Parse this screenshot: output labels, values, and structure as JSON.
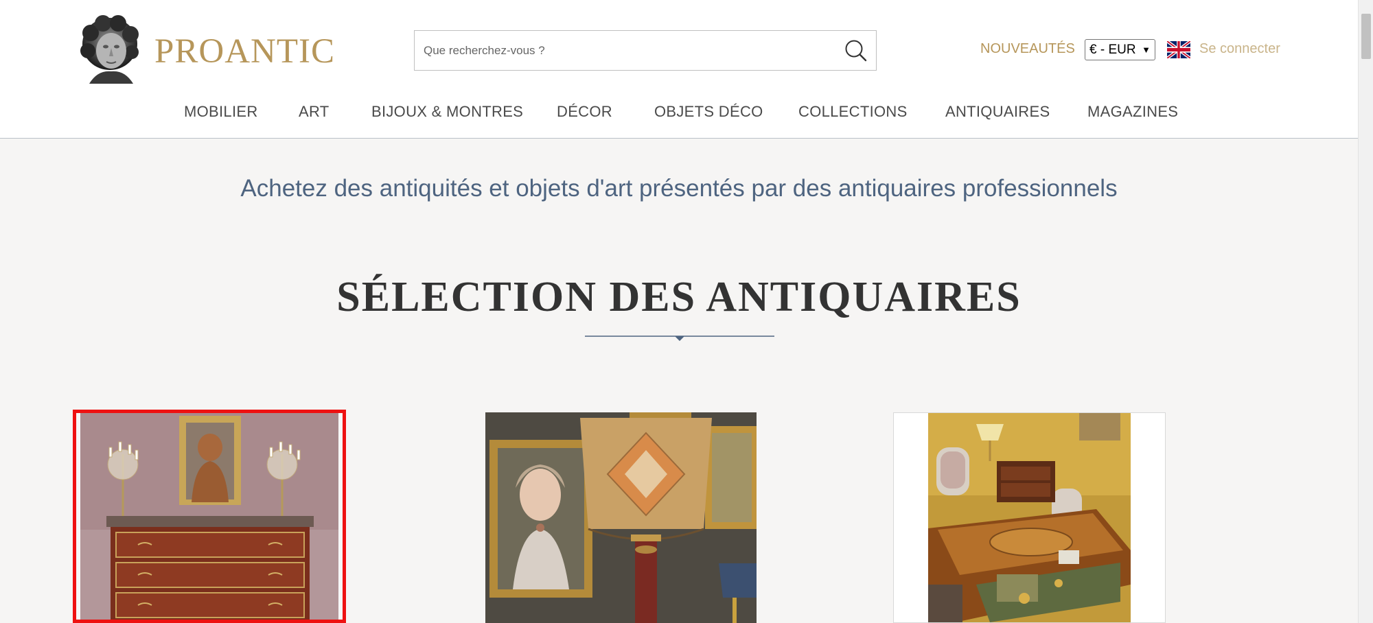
{
  "header": {
    "logo_text": "PROANTIC",
    "search_placeholder": "Que recherchez-vous ?",
    "new_link": "NOUVEAUTÉS",
    "currency_selected": "€ - EUR",
    "login_link": "Se connecter"
  },
  "nav": [
    {
      "label": "MOBILIER"
    },
    {
      "label": "ART"
    },
    {
      "label": "BIJOUX & MONTRES"
    },
    {
      "label": "DÉCOR"
    },
    {
      "label": "OBJETS DÉCO"
    },
    {
      "label": "COLLECTIONS"
    },
    {
      "label": "ANTIQUAIRES"
    },
    {
      "label": "MAGAZINES"
    }
  ],
  "main": {
    "tagline": "Achetez des antiquités et objets d'art présentés par des antiquaires professionnels",
    "section_title": "SÉLECTION DES ANTIQUAIRES"
  },
  "colors": {
    "brand_gold": "#b6965a",
    "tagline_blue": "#4e6480",
    "selected_border": "#ee1111"
  },
  "icons": {
    "search": "search-icon",
    "flag": "uk-flag-icon"
  }
}
